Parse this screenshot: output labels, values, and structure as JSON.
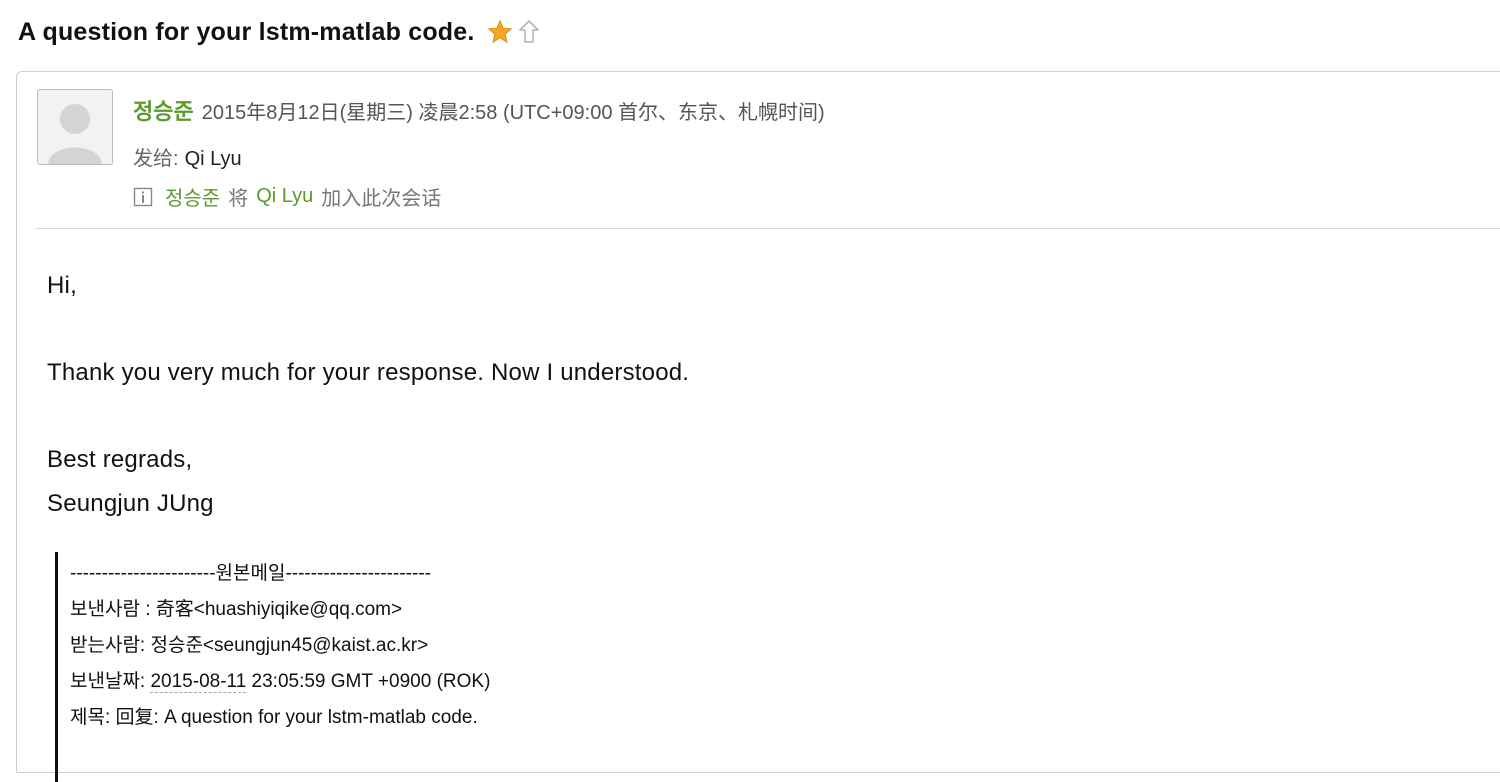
{
  "subject": "A question for your lstm-matlab code.",
  "icons": {
    "star": "star-icon",
    "share": "share-icon",
    "info": "info-icon",
    "avatar": "avatar-placeholder"
  },
  "colors": {
    "sender_green": "#5b9a2d",
    "star_gold": "#f5a623"
  },
  "header": {
    "sender_name": "정승준",
    "date": "2015年8月12日(星期三) 凌晨2:58 (UTC+09:00 首尔、东京、札幌时间)",
    "to_label": "发给:",
    "to_name": "Qi Lyu",
    "added_notice": {
      "sender": "정승준",
      "verb": "将",
      "target": "Qi Lyu",
      "suffix": "加入此次会话"
    }
  },
  "body": {
    "greeting": "Hi,",
    "message": "Thank you very much for your response. Now I understood.",
    "closing": "Best regrads,",
    "signature": "Seungjun JUng"
  },
  "quoted": {
    "separator": "-----------------------원본메일-----------------------",
    "from": "보낸사람 : 奇客<huashiyiqike@qq.com>",
    "to": "받는사람: 정승준<seungjun45@kaist.ac.kr>",
    "date_label": "보낸날짜: ",
    "date_value": "2015-08-11",
    "date_rest": " 23:05:59 GMT +0900 (ROK)",
    "subject": "제목: 回复:  A question for your lstm-matlab code."
  }
}
